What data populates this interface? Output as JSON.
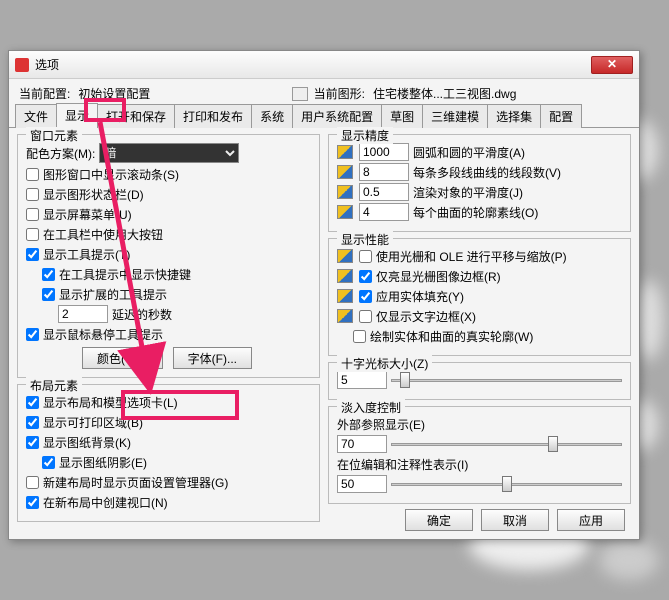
{
  "app_icon_label": "A",
  "window_title": "选项",
  "info": {
    "current_profile_label": "当前配置:",
    "current_profile_value": "初始设置配置",
    "current_drawing_label": "当前图形:",
    "current_drawing_value": "住宅楼整体...工三视图.dwg"
  },
  "tabs": [
    "文件",
    "显示",
    "打开和保存",
    "打印和发布",
    "系统",
    "用户系统配置",
    "草图",
    "三维建模",
    "选择集",
    "配置"
  ],
  "active_tab_index": 1,
  "left": {
    "window_elements": {
      "title": "窗口元素",
      "color_scheme_label": "配色方案(M):",
      "color_scheme_value": "暗",
      "scrollbars": "图形窗口中显示滚动条(S)",
      "statusbar": "显示图形状态栏(D)",
      "screen_menu": "显示屏幕菜单(U)",
      "large_buttons": "在工具栏中使用大按钮",
      "tooltips": "显示工具提示(T)",
      "shortcuts": "在工具提示中显示快捷键",
      "ext_tooltips": "显示扩展的工具提示",
      "delay_value": "2",
      "delay_label": "延迟的秒数",
      "rollover": "显示鼠标悬停工具提示",
      "colors_btn": "颜色(C)...",
      "fonts_btn": "字体(F)..."
    },
    "layout_elements": {
      "title": "布局元素",
      "tabs": "显示布局和模型选项卡(L)",
      "printable": "显示可打印区域(B)",
      "paper_bg": "显示图纸背景(K)",
      "paper_shadow": "显示图纸阴影(E)",
      "page_setup": "新建布局时显示页面设置管理器(G)",
      "viewport": "在新布局中创建视口(N)"
    }
  },
  "right": {
    "resolution": {
      "title": "显示精度",
      "arc_value": "1000",
      "arc_label": "圆弧和圆的平滑度(A)",
      "seg_value": "8",
      "seg_label": "每条多段线曲线的线段数(V)",
      "render_value": "0.5",
      "render_label": "渲染对象的平滑度(J)",
      "contour_value": "4",
      "contour_label": "每个曲面的轮廓素线(O)"
    },
    "performance": {
      "title": "显示性能",
      "pan_zoom": "使用光栅和 OLE 进行平移与缩放(P)",
      "highlight_frame": "仅亮显光栅图像边框(R)",
      "solid_fill": "应用实体填充(Y)",
      "text_frame": "仅显示文字边框(X)",
      "true_silh": "绘制实体和曲面的真实轮廓(W)"
    },
    "crosshair": {
      "title": "十字光标大小(Z)",
      "value": "5"
    },
    "fade": {
      "title": "淡入度控制",
      "xref_label": "外部参照显示(E)",
      "xref_value": "70",
      "inplace_label": "在位编辑和注释性表示(I)",
      "inplace_value": "50"
    }
  },
  "footer": {
    "ok": "确定",
    "cancel": "取消",
    "apply": "应用"
  }
}
